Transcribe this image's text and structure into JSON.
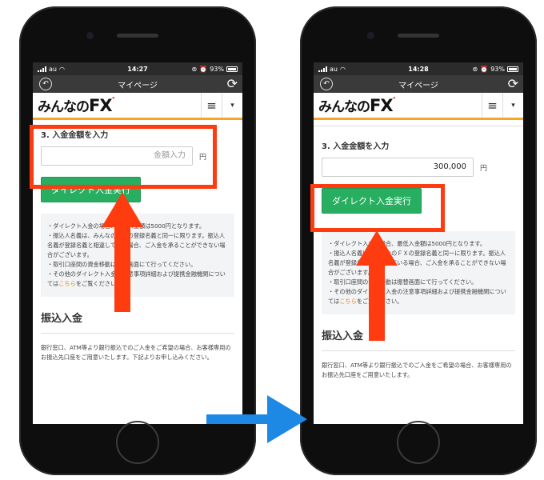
{
  "status_left": {
    "carrier": "au",
    "time": "14:27",
    "battery": "93%"
  },
  "status_right": {
    "carrier": "au",
    "time": "14:28",
    "battery": "93%"
  },
  "nav": {
    "title": "マイページ",
    "back_icon": "back-arrow-icon",
    "reload_icon": "reload-icon"
  },
  "logo": {
    "text_main": "みんなの",
    "text_fx": "FX"
  },
  "menu": {
    "hamburger": "≡",
    "dropdown": "▾"
  },
  "deposit": {
    "section_label": "3. 入金金額を入力",
    "placeholder": "金額入力",
    "value_filled": "300,000",
    "unit": "円",
    "button_label": "ダイレクト入金実行"
  },
  "notes_left": [
    "・ダイレクト入金の場合、最低入金額は5000円となります。",
    "・振込人名義は、みんなのＦＸの登録名義と同一に限ります。振込人名義が登録名義と相違している場合、ご入金を承ることができない場合がございます。",
    "・取引口座間の資金移動は振替画面にて行ってください。"
  ],
  "notes_left_last_pre": "・その他のダイレクト入金の注意事項詳細および提携金融機関については",
  "notes_right": [
    "・ダイレクト入金の場合、最低入金額は5000円となります。",
    "・振込人名義は、みんなのＦＸの登録名義と同一に限ります。振込人名義が登録名義と相違している場合、ご入金を承ることができない場合がございます。",
    "・取引口座間の資金移動は振替画面にて行ってください。"
  ],
  "notes_right_last_pre": "・その他のダイレクト入金の注意事項詳細および提携金融機関については",
  "notes_link": "こちら",
  "notes_post": "をご覧ください。",
  "furikomi": {
    "title": "振込入金",
    "text_left": "銀行窓口、ATM等より銀行振込でのご入金をご希望の場合、お客様専用のお振込先口座をご用意いたします。下記よりお申し込みください。",
    "text_right": "銀行窓口、ATM等より銀行振込でのご入金をご希望の場合、お客様専用のお振込先口座をご用意いたします。"
  },
  "colors": {
    "highlight": "#ff3b10",
    "accent_orange": "#f5a623",
    "button_green": "#27ae60",
    "arrow_blue": "#1e88e5"
  }
}
